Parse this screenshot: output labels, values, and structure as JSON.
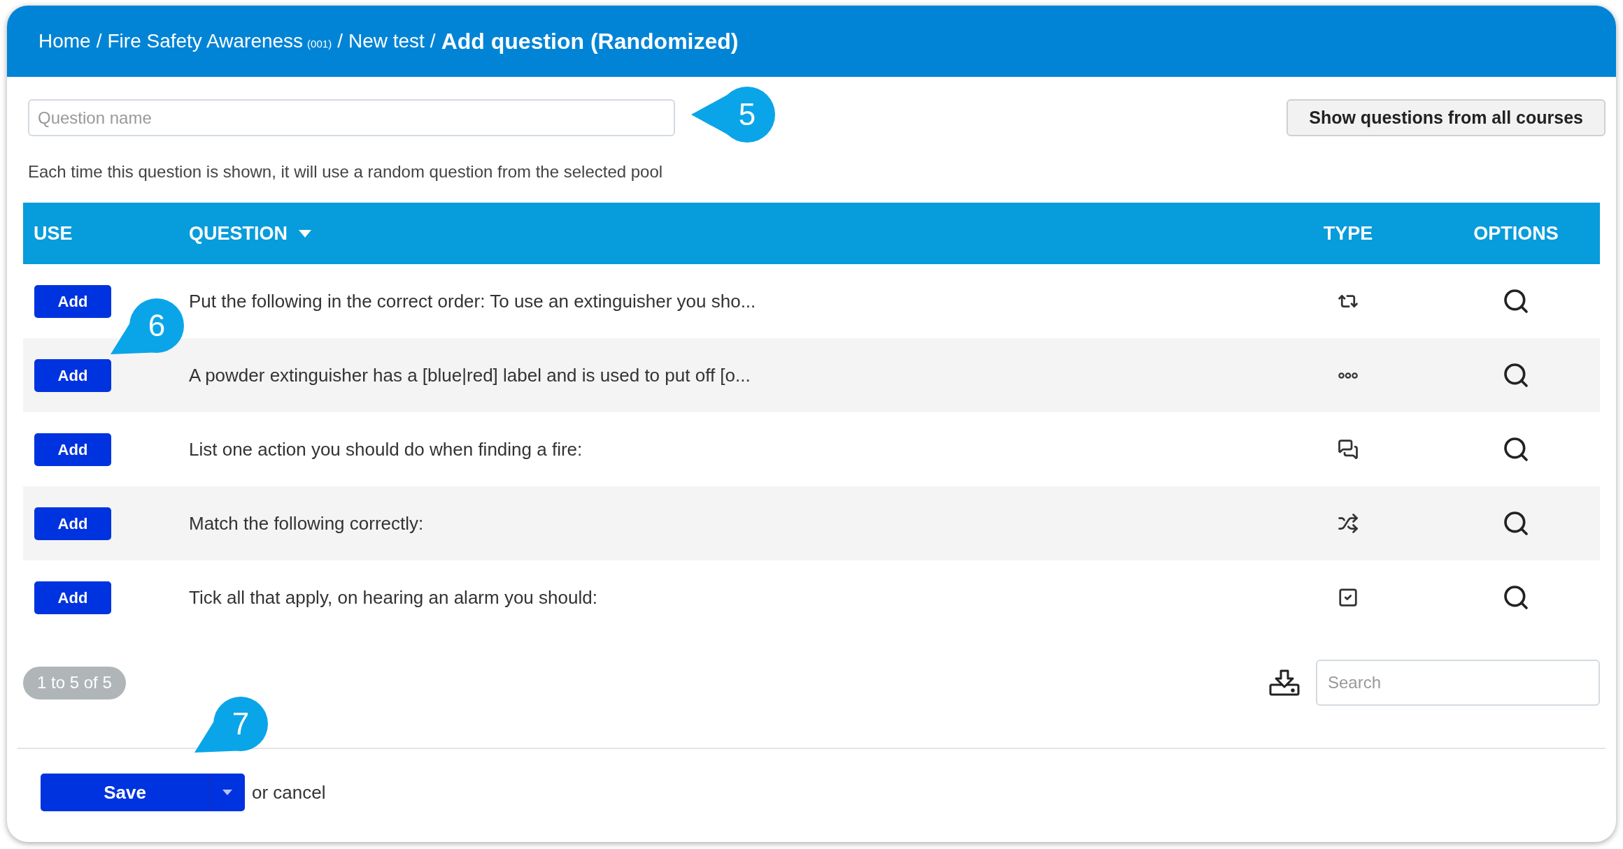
{
  "breadcrumb": [
    {
      "label": "Home"
    },
    {
      "label": "Fire Safety Awareness",
      "code": "(001)"
    },
    {
      "label": "New test"
    }
  ],
  "separator": "/",
  "title": "Add question (Randomized)",
  "name_field": {
    "placeholder": "Question name"
  },
  "show_all_button": "Show questions from all courses",
  "hint": "Each time this question is shown, it will use a random question from the selected pool",
  "columns": [
    {
      "label": "USE",
      "sorted": false
    },
    {
      "label": "QUESTION",
      "sorted": true
    },
    {
      "label": "TYPE",
      "sorted": false
    },
    {
      "label": "OPTIONS",
      "sorted": false
    }
  ],
  "rows": [
    {
      "action": "Add",
      "question": "Put the following in the correct order: To use an extinguisher you sho...",
      "kind": "order"
    },
    {
      "action": "Add",
      "question": "A powder extinguisher has a [blue|red] label and is used to put off [o...",
      "kind": "fill"
    },
    {
      "action": "Add",
      "question": "List one action you should do when finding a fire:",
      "kind": "text"
    },
    {
      "action": "Add",
      "question": "Match the following correctly:",
      "kind": "match"
    },
    {
      "action": "Add",
      "question": "Tick all that apply, on hearing an alarm you should:",
      "kind": "multiple"
    }
  ],
  "pagination": "1 to 5 of 5",
  "search": {
    "placeholder": "Search"
  },
  "save_button": "Save",
  "cancel_text": "or cancel",
  "callouts": [
    {
      "number": "5",
      "kind": "left"
    },
    {
      "number": "6",
      "kind": "corner"
    },
    {
      "number": "7",
      "kind": "corner"
    }
  ]
}
